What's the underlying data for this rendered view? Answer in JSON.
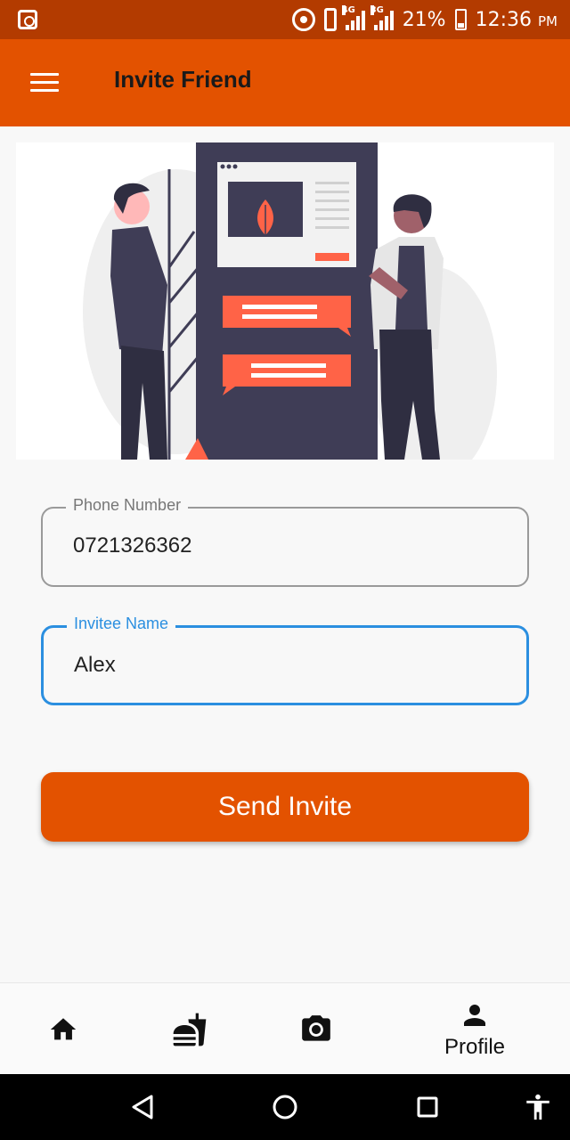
{
  "status_bar": {
    "network_1": "4G",
    "network_2": "3G",
    "battery": "21%",
    "time": "12:36",
    "ampm": "PM"
  },
  "app_bar": {
    "title": "Invite Friend",
    "menu_icon": "hamburger-menu-icon"
  },
  "form": {
    "phone": {
      "label": "Phone Number",
      "value": "0721326362"
    },
    "invitee": {
      "label": "Invitee Name",
      "value": "Alex"
    },
    "submit_label": "Send Invite"
  },
  "bottom_nav": {
    "items": [
      {
        "icon": "home-icon",
        "label": ""
      },
      {
        "icon": "fastfood-icon",
        "label": ""
      },
      {
        "icon": "camera-icon",
        "label": ""
      },
      {
        "icon": "person-icon",
        "label": "Profile"
      }
    ]
  },
  "colors": {
    "primary": "#e35200",
    "status_bar": "#b33b00",
    "focus": "#2b8fe0",
    "illustration_dark": "#3f3d56",
    "illustration_accent": "#ff6347"
  }
}
